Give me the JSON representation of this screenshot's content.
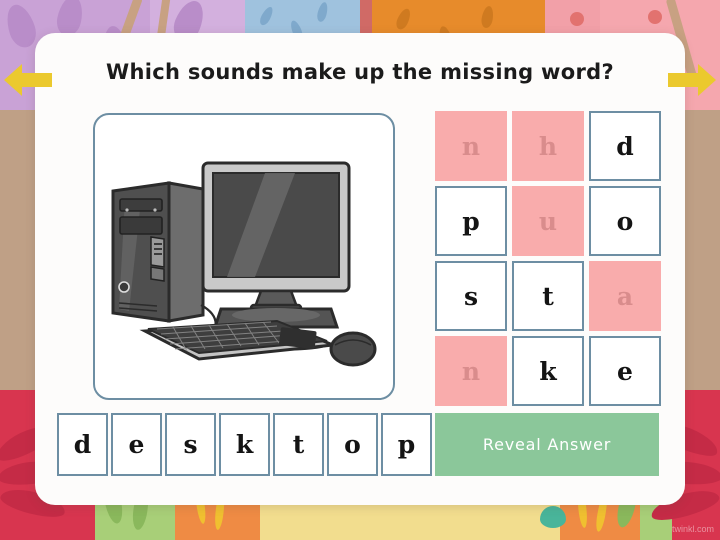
{
  "title": "Which sounds make up the missing word?",
  "nav": {
    "prev_label": "Previous",
    "next_label": "Next",
    "prev_icon": "arrow-left-icon",
    "next_icon": "arrow-right-icon",
    "arrow_color": "#ebc92e"
  },
  "image_panel": {
    "alt": "desktop computer with tower, monitor, keyboard and mouse",
    "icon": "desktop-computer-image"
  },
  "word": {
    "answer": "desktop",
    "tiles": [
      "d",
      "e",
      "s",
      "k",
      "t",
      "o",
      "p"
    ]
  },
  "letter_grid": {
    "rows": 4,
    "cols": 3,
    "cells": [
      {
        "letter": "n",
        "state": "highlight"
      },
      {
        "letter": "h",
        "state": "highlight"
      },
      {
        "letter": "d",
        "state": "plain"
      },
      {
        "letter": "p",
        "state": "plain"
      },
      {
        "letter": "u",
        "state": "highlight"
      },
      {
        "letter": "o",
        "state": "plain"
      },
      {
        "letter": "s",
        "state": "plain"
      },
      {
        "letter": "t",
        "state": "plain"
      },
      {
        "letter": "a",
        "state": "highlight"
      },
      {
        "letter": "n",
        "state": "highlight"
      },
      {
        "letter": "k",
        "state": "plain"
      },
      {
        "letter": "e",
        "state": "plain"
      }
    ]
  },
  "reveal_button": {
    "label": "Reveal Answer",
    "bg_color": "#8bc79a",
    "text_color": "#ffffff"
  },
  "watermark": "twinkl.com",
  "colors": {
    "tile_border": "#6d8ea3",
    "highlight_bg": "#f9acac",
    "highlight_text": "#d98c8c",
    "card_bg": "#fdfcfb",
    "title_text": "#1b1b1b"
  }
}
